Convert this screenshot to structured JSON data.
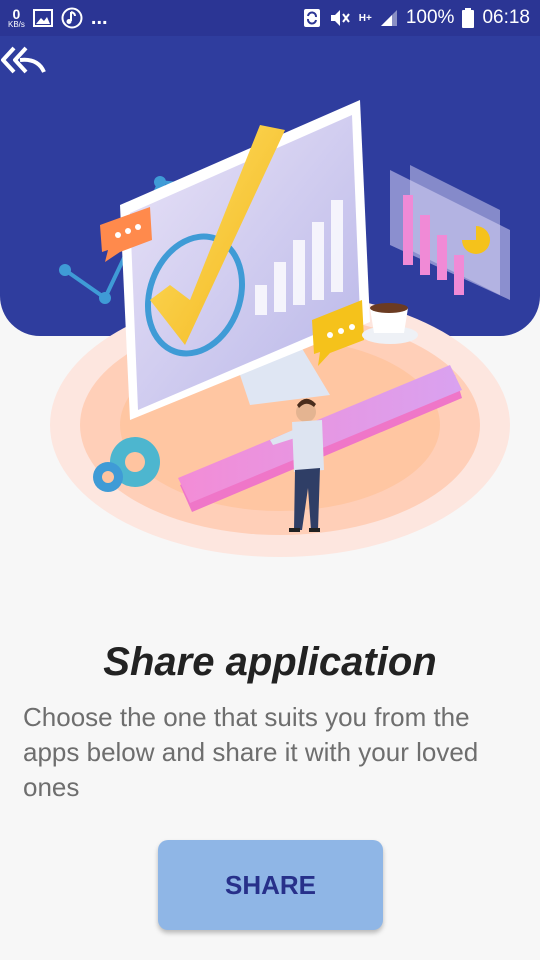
{
  "status_bar": {
    "speed_value": "0",
    "speed_unit": "KB/s",
    "more": "...",
    "network": "H+",
    "battery": "100%",
    "time": "06:18",
    "icons": [
      "image-icon",
      "music-note-icon",
      "sync-icon",
      "mute-icon",
      "signal-icon",
      "battery-icon"
    ]
  },
  "header": {
    "back_icon": "double-back-arrow-icon"
  },
  "content": {
    "title": "Share application",
    "description": "Choose the one that suits you from the apps below and share it with your loved ones",
    "share_label": "SHARE"
  },
  "colors": {
    "status_bar": "#2b3594",
    "hero": "#2f3d9e",
    "button_bg": "#8fb6e6",
    "button_text": "#27308a",
    "accent_yellow": "#f5c21b",
    "accent_pink": "#f08ad6"
  }
}
